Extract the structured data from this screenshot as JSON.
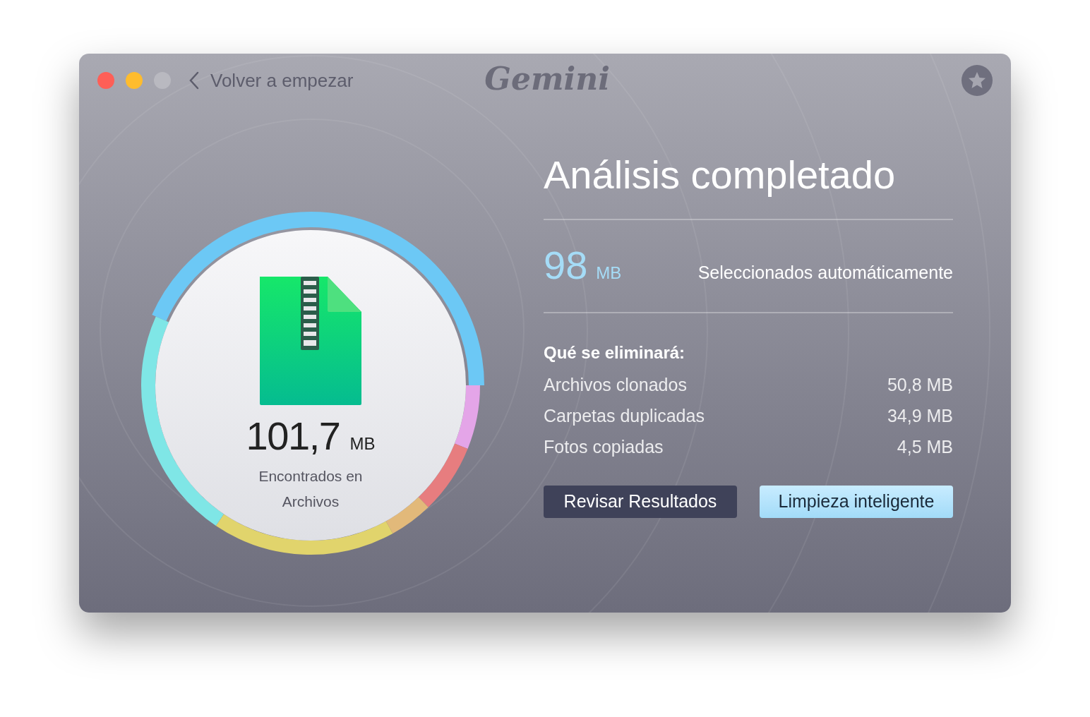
{
  "window": {
    "back_label": "Volver a empezar",
    "logo": "Gemini"
  },
  "summary": {
    "size": "101,7",
    "unit": "MB",
    "caption": "Encontrados en Archivos"
  },
  "title": "Análisis completado",
  "selected": {
    "size": "98",
    "unit": "MB",
    "label": "Seleccionados automáticamente"
  },
  "removal": {
    "heading": "Qué se eliminará:",
    "items": [
      {
        "label": "Archivos clonados",
        "size": "50,8 MB"
      },
      {
        "label": "Carpetas duplicadas",
        "size": "34,9 MB"
      },
      {
        "label": "Fotos copiadas",
        "size": "4,5 MB"
      }
    ]
  },
  "buttons": [
    {
      "label": "Revisar Resultados",
      "kind": "secondary"
    },
    {
      "label": "Limpieza inteligente",
      "kind": "primary"
    }
  ]
}
